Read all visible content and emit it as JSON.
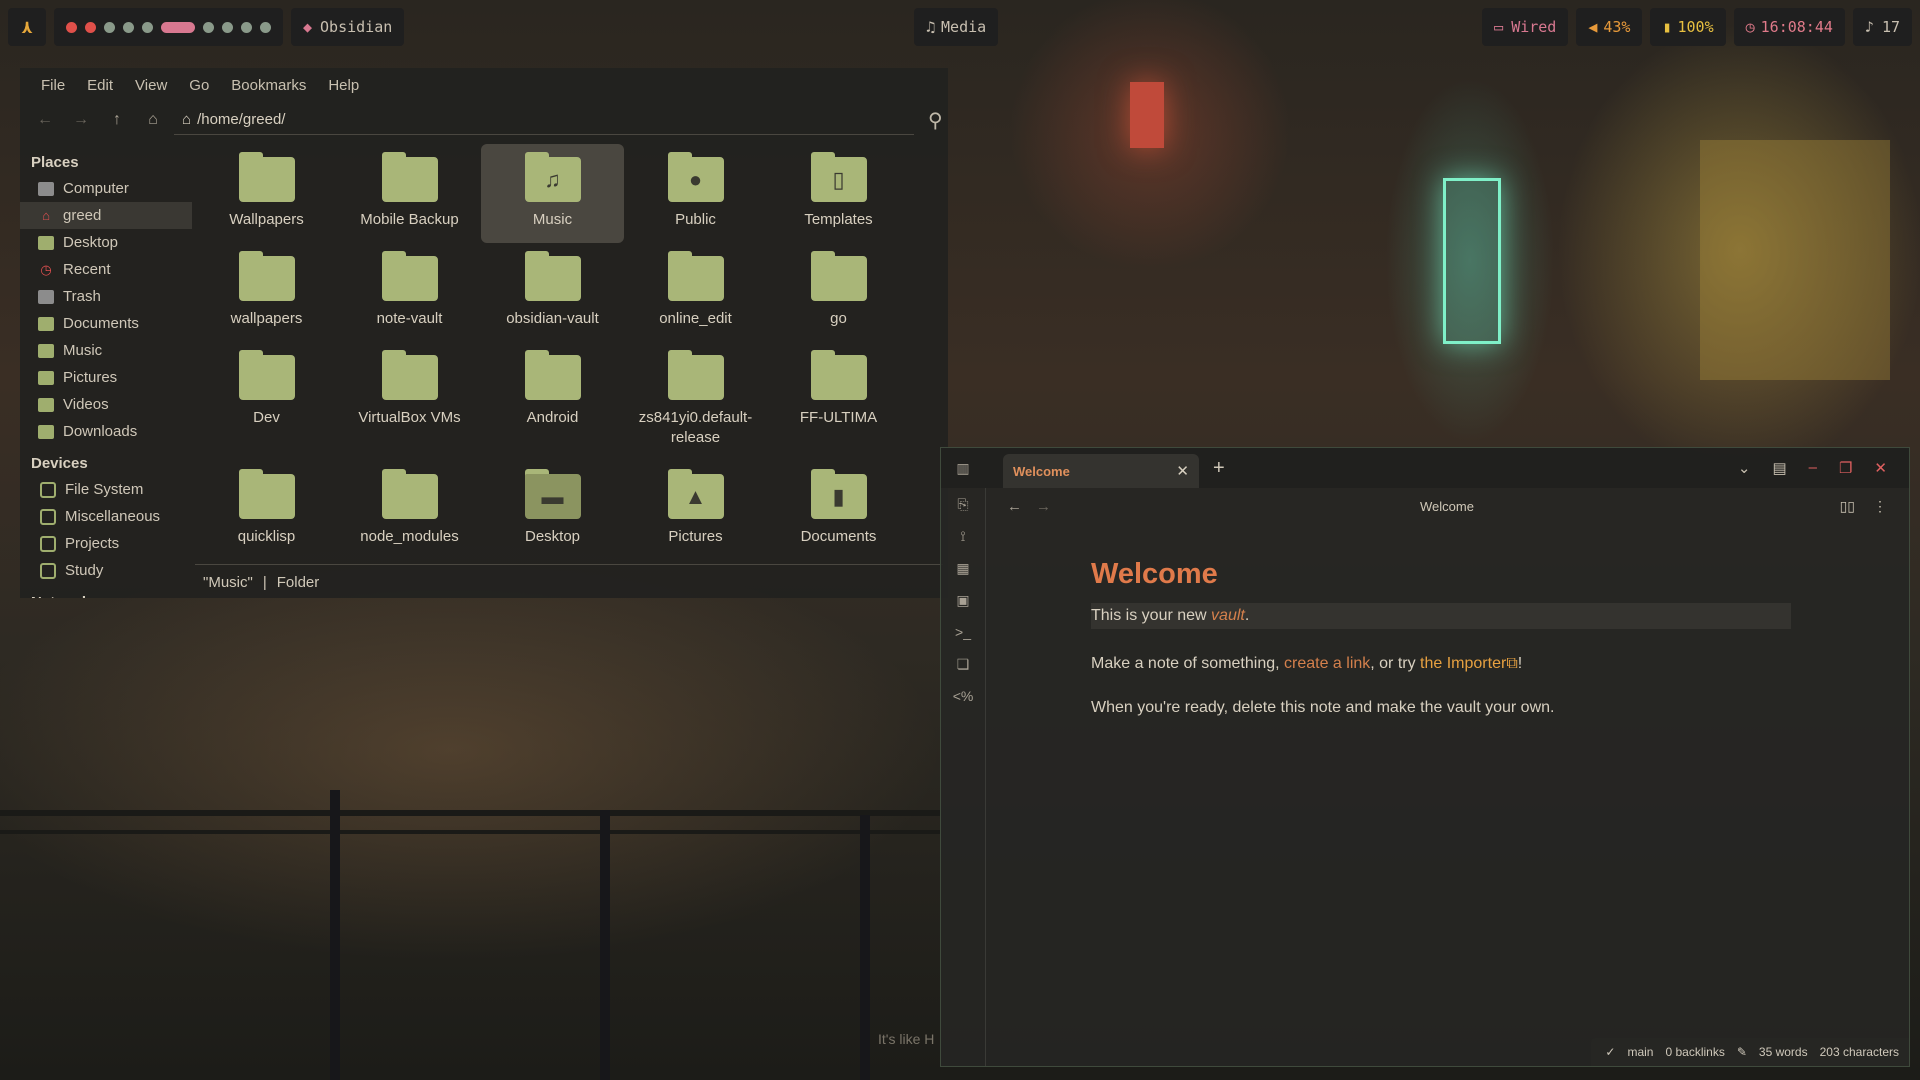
{
  "topbar": {
    "logo": "⋏",
    "workspaces": [
      "red",
      "red",
      "gray",
      "gray",
      "gray",
      "active",
      "gray",
      "gray",
      "gray",
      "gray"
    ],
    "active_app": "Obsidian",
    "media": "Media",
    "network": "Wired",
    "volume": "43%",
    "battery": "100%",
    "clock": "16:08:44",
    "notifications": "17"
  },
  "file_manager": {
    "menu": [
      "File",
      "Edit",
      "View",
      "Go",
      "Bookmarks",
      "Help"
    ],
    "path": "/home/greed/",
    "places_title": "Places",
    "places": [
      {
        "label": "Computer",
        "icon": "computer-icon"
      },
      {
        "label": "greed",
        "icon": "home-icon",
        "selected": true
      },
      {
        "label": "Desktop",
        "icon": "folder-icon"
      },
      {
        "label": "Recent",
        "icon": "clock-icon"
      },
      {
        "label": "Trash",
        "icon": "trash-icon"
      },
      {
        "label": "Documents",
        "icon": "folder-icon"
      },
      {
        "label": "Music",
        "icon": "folder-icon"
      },
      {
        "label": "Pictures",
        "icon": "folder-icon"
      },
      {
        "label": "Videos",
        "icon": "folder-icon"
      },
      {
        "label": "Downloads",
        "icon": "folder-icon"
      }
    ],
    "devices_title": "Devices",
    "devices": [
      "File System",
      "Miscellaneous",
      "Projects",
      "Study"
    ],
    "network_title": "Network",
    "items": [
      {
        "label": "Wallpapers",
        "glyph": ""
      },
      {
        "label": "Mobile Backup",
        "glyph": ""
      },
      {
        "label": "Music",
        "glyph": "♫",
        "selected": true
      },
      {
        "label": "Public",
        "glyph": "●"
      },
      {
        "label": "Templates",
        "glyph": "▯"
      },
      {
        "label": "wallpapers",
        "glyph": ""
      },
      {
        "label": "note-vault",
        "glyph": ""
      },
      {
        "label": "obsidian-vault",
        "glyph": ""
      },
      {
        "label": "online_edit",
        "glyph": ""
      },
      {
        "label": "go",
        "glyph": ""
      },
      {
        "label": "Dev",
        "glyph": ""
      },
      {
        "label": "VirtualBox VMs",
        "glyph": ""
      },
      {
        "label": "Android",
        "glyph": ""
      },
      {
        "label": "zs841yi0.default-release",
        "glyph": ""
      },
      {
        "label": "FF-ULTIMA",
        "glyph": ""
      },
      {
        "label": "quicklisp",
        "glyph": ""
      },
      {
        "label": "node_modules",
        "glyph": ""
      },
      {
        "label": "Desktop",
        "glyph": "▬"
      },
      {
        "label": "Pictures",
        "glyph": "▲"
      },
      {
        "label": "Documents",
        "glyph": "▮"
      }
    ],
    "status_name": "\"Music\"",
    "status_sep": "|",
    "status_type": "Folder"
  },
  "obsidian": {
    "tab_title": "Welcome",
    "nav_title": "Welcome",
    "note_title": "Welcome",
    "line1_prefix": "This is your new ",
    "line1_link": "vault",
    "line1_suffix": ".",
    "line2_prefix": "Make a note of something, ",
    "line2_link1": "create a link",
    "line2_mid": ", or try ",
    "line2_link2": "the Importer",
    "line2_suffix": "!",
    "line3": "When you're ready, delete this note and make the vault your own.",
    "status": {
      "branch": "main",
      "backlinks": "0 backlinks",
      "words": "35 words",
      "characters": "203 characters"
    }
  },
  "wallpaper_caption": "It's like H",
  "colors": {
    "accent": "#e07a4a",
    "folder": "#a9b678",
    "pink": "#d87890"
  }
}
